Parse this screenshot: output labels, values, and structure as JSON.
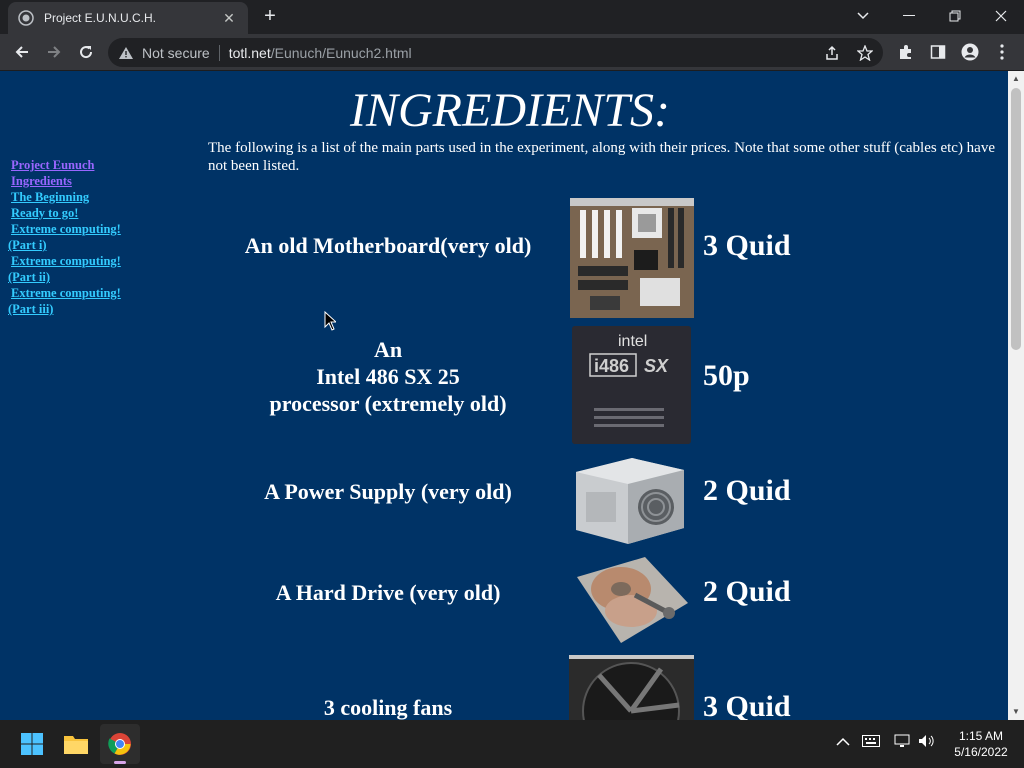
{
  "browser": {
    "tab_title": "Project E.U.N.U.C.H.",
    "security_label": "Not secure",
    "url_host": "totl.net",
    "url_path": "/Eunuch/Eunuch2.html"
  },
  "page": {
    "heading": "INGREDIENTS:",
    "intro": "The following is a list of the main parts used in the experiment, along with their prices. Note that some other stuff (cables etc) have not been listed.",
    "nav": [
      {
        "label": "Project Eunuch"
      },
      {
        "label": "Ingredients"
      },
      {
        "label": "The Beginning"
      },
      {
        "label": "Ready to go!"
      },
      {
        "label": "Extreme computing!"
      },
      {
        "label": "(Part i)"
      },
      {
        "label": "Extreme computing!"
      },
      {
        "label": "(Part ii)"
      },
      {
        "label": "Extreme computing!"
      },
      {
        "label": "(Part iii)"
      }
    ],
    "items": [
      {
        "name": "An old Motherboard(very old)",
        "price": "3 Quid"
      },
      {
        "name_line1": "An",
        "name_line2": "Intel 486 SX 25",
        "name_line3": "processor (extremely old)",
        "price": "50p",
        "chip_brand": "intel",
        "chip_model": "i486",
        "chip_suffix": "SX"
      },
      {
        "name": "A Power Supply (very old)",
        "price": "2 Quid"
      },
      {
        "name": "A Hard Drive (very old)",
        "price": "2 Quid"
      },
      {
        "name": "3 cooling fans",
        "price": "3 Quid"
      }
    ]
  },
  "taskbar": {
    "time": "1:15 AM",
    "date": "5/16/2022"
  }
}
